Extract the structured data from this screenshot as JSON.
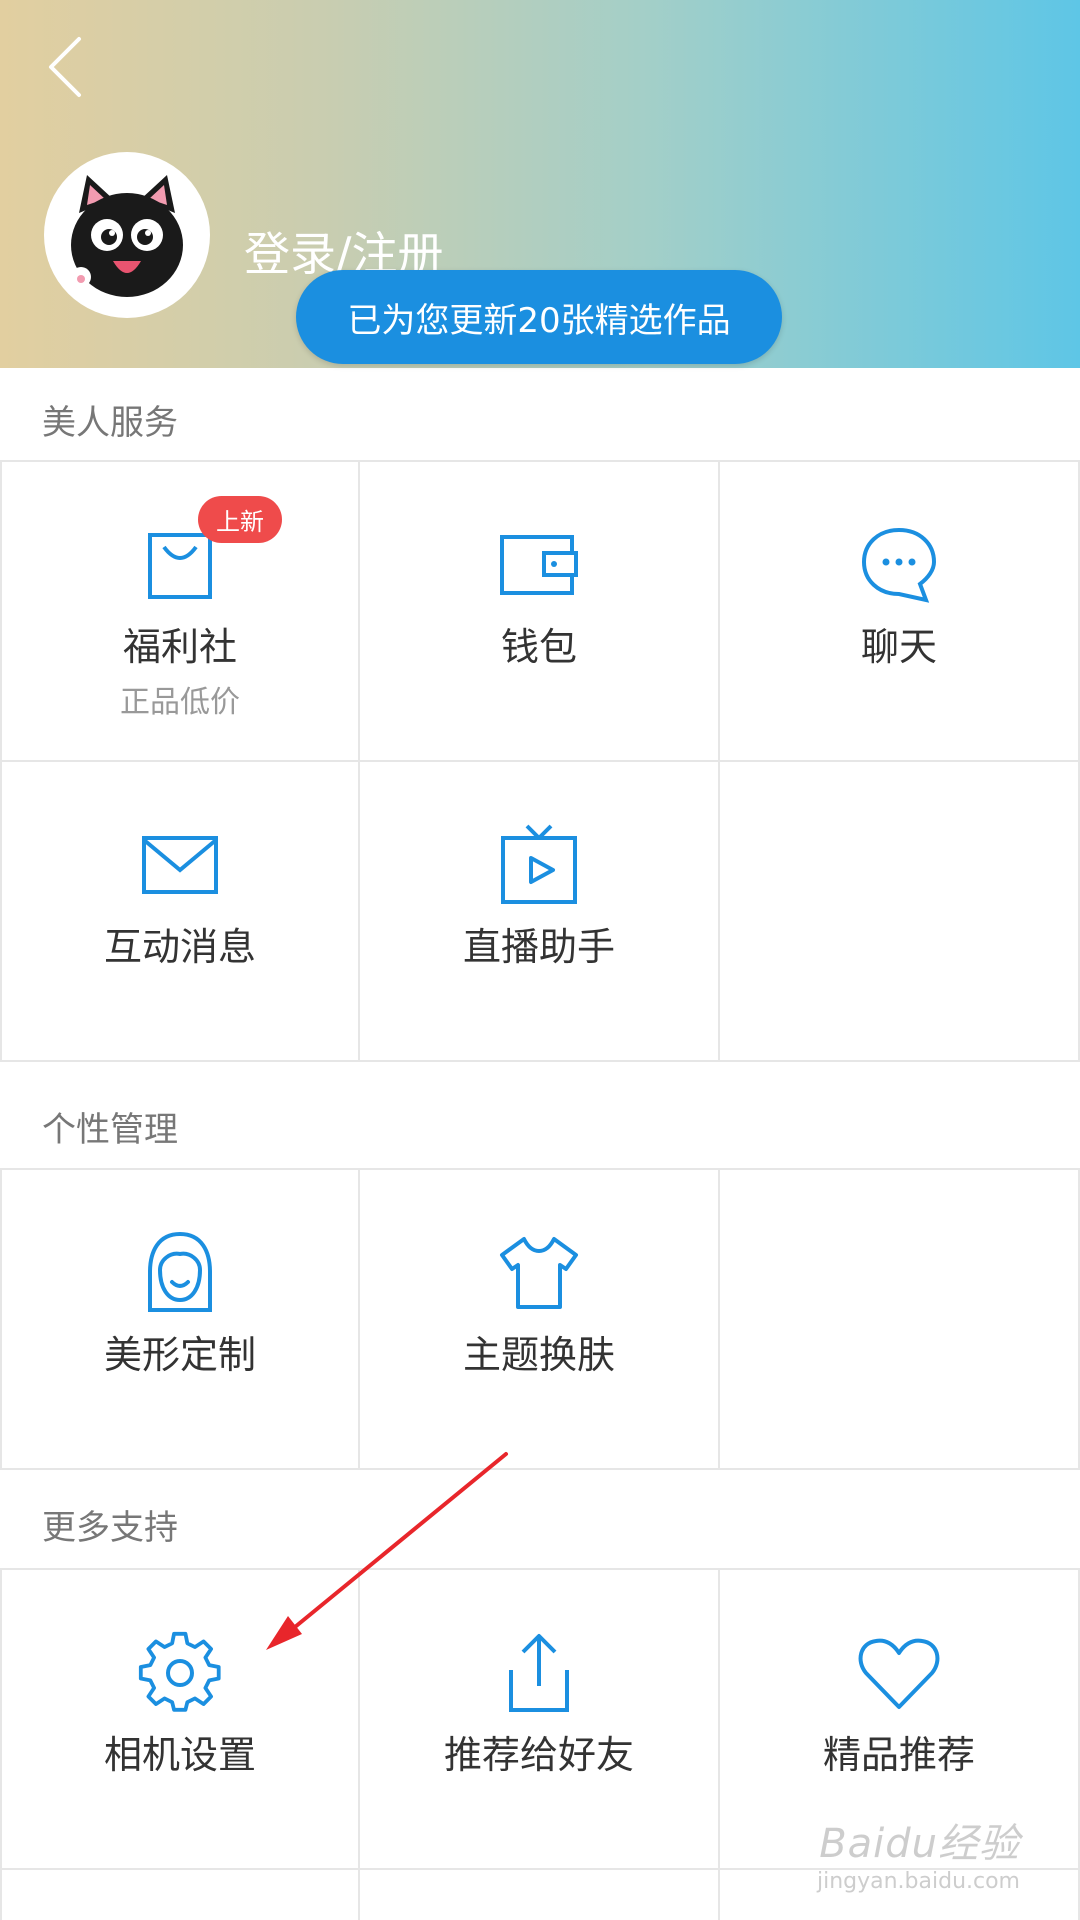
{
  "header": {
    "back_icon": "chevron-left-icon",
    "login_label": "登录/注册",
    "update_notice": "已为您更新20张精选作品",
    "avatar_icon": "cat-avatar-icon"
  },
  "sections": [
    {
      "title": "美人服务",
      "items": [
        {
          "label": "福利社",
          "sublabel": "正品低价",
          "badge": "上新",
          "icon": "shopping-bag-icon"
        },
        {
          "label": "钱包",
          "icon": "wallet-icon"
        },
        {
          "label": "聊天",
          "icon": "chat-bubble-icon"
        },
        {
          "label": "互动消息",
          "icon": "envelope-icon"
        },
        {
          "label": "直播助手",
          "icon": "tv-play-icon"
        }
      ]
    },
    {
      "title": "个性管理",
      "items": [
        {
          "label": "美形定制",
          "icon": "face-icon"
        },
        {
          "label": "主题换肤",
          "icon": "tshirt-icon"
        }
      ]
    },
    {
      "title": "更多支持",
      "items": [
        {
          "label": "相机设置",
          "icon": "gear-icon"
        },
        {
          "label": "推荐给好友",
          "icon": "share-icon"
        },
        {
          "label": "精品推荐",
          "icon": "heart-icon"
        }
      ]
    }
  ],
  "watermark": {
    "main": "Baidu经验",
    "sub": "jingyan.baidu.com"
  },
  "colors": {
    "accent": "#1b8fe0",
    "badge": "#ef4b4b",
    "annotation_arrow": "#e8262b"
  }
}
